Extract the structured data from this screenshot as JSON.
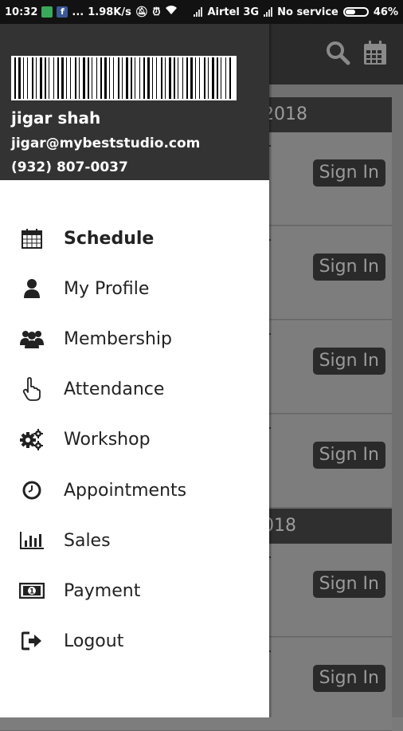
{
  "status_bar": {
    "time": "10:32",
    "net_speed": "1.98K/s",
    "dots": "...",
    "carrier1": "Airtel 3G",
    "carrier2": "No service",
    "battery": "46%",
    "battery_level": 0.46
  },
  "toolbar": {
    "search_icon": "search-icon",
    "calendar_icon": "calendar-icon"
  },
  "background": {
    "date_headers": [
      "2018",
      "018"
    ],
    "sign_in_label": "Sign In"
  },
  "drawer": {
    "user": {
      "name": "jigar shah",
      "email": "jigar@mybeststudio.com",
      "phone": "(932) 807-0037"
    },
    "menu": [
      {
        "label": "Schedule",
        "icon": "calendar-icon",
        "active": true
      },
      {
        "label": "My Profile",
        "icon": "user-icon"
      },
      {
        "label": "Membership",
        "icon": "users-icon"
      },
      {
        "label": "Attendance",
        "icon": "hand-pointer-icon"
      },
      {
        "label": "Workshop",
        "icon": "gears-icon"
      },
      {
        "label": "Appointments",
        "icon": "clock-icon"
      },
      {
        "label": "Sales",
        "icon": "bar-chart-icon"
      },
      {
        "label": "Payment",
        "icon": "money-icon"
      },
      {
        "label": "Logout",
        "icon": "logout-icon"
      }
    ]
  }
}
